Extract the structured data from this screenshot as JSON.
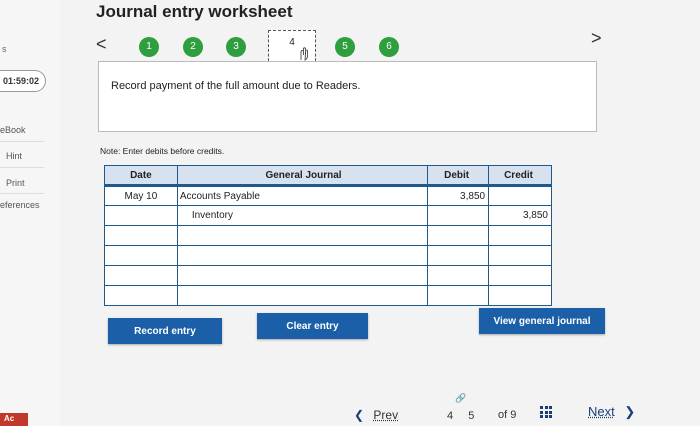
{
  "header": {
    "title": "Journal entry worksheet"
  },
  "left_rail": {
    "partial_label": "s",
    "timer": "01:59:02",
    "links": [
      "eBook",
      "Hint",
      "Print",
      "eferences"
    ],
    "badge": "Ac"
  },
  "steps": {
    "prev_arrow": "<",
    "next_arrow": ">",
    "items": [
      "1",
      "2",
      "3",
      "4",
      "5",
      "6"
    ],
    "current_index": 3,
    "completed_color": "#2e9e3f"
  },
  "prompt": {
    "text": "Record payment of the full amount due to Readers."
  },
  "note": "Note: Enter debits before credits.",
  "journal": {
    "headers": {
      "date": "Date",
      "account": "General Journal",
      "debit": "Debit",
      "credit": "Credit"
    },
    "rows": [
      {
        "date": "May 10",
        "account": "Accounts Payable",
        "debit": "3,850",
        "credit": ""
      },
      {
        "date": "",
        "account": "Inventory",
        "debit": "",
        "credit": "3,850"
      },
      {
        "date": "",
        "account": "",
        "debit": "",
        "credit": ""
      },
      {
        "date": "",
        "account": "",
        "debit": "",
        "credit": ""
      },
      {
        "date": "",
        "account": "",
        "debit": "",
        "credit": ""
      },
      {
        "date": "",
        "account": "",
        "debit": "",
        "credit": ""
      }
    ]
  },
  "buttons": {
    "record": "Record entry",
    "clear": "Clear entry",
    "view": "View general journal",
    "color": "#1a5fa8"
  },
  "footer": {
    "prev": "Prev",
    "page_current": "4",
    "page_next": "5",
    "of": "of 9",
    "next": "Next"
  }
}
